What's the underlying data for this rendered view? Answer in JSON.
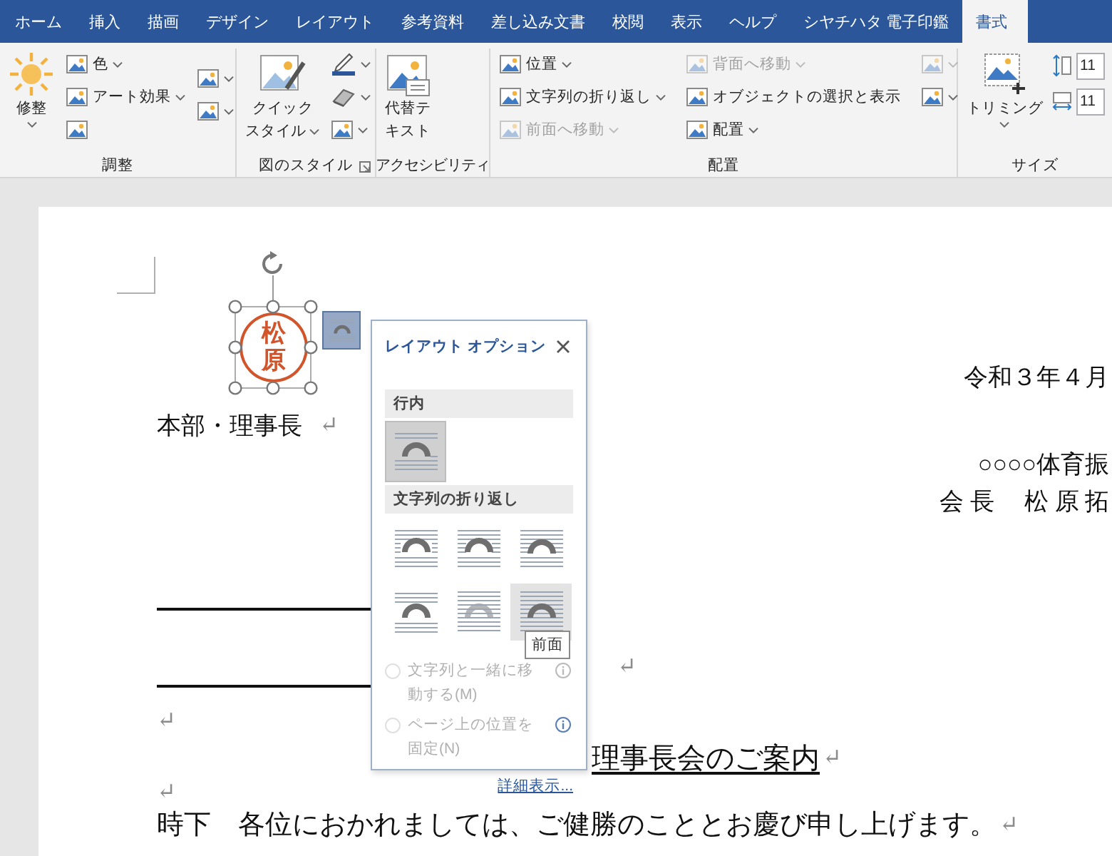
{
  "tabs": [
    {
      "label": "ホーム",
      "selected": false
    },
    {
      "label": "挿入",
      "selected": false
    },
    {
      "label": "描画",
      "selected": false
    },
    {
      "label": "デザイン",
      "selected": false
    },
    {
      "label": "レイアウト",
      "selected": false
    },
    {
      "label": "参考資料",
      "selected": false
    },
    {
      "label": "差し込み文書",
      "selected": false
    },
    {
      "label": "校閲",
      "selected": false
    },
    {
      "label": "表示",
      "selected": false
    },
    {
      "label": "ヘルプ",
      "selected": false
    },
    {
      "label": "シヤチハタ 電子印鑑",
      "selected": false
    },
    {
      "label": "書式",
      "selected": true
    }
  ],
  "ribbon": {
    "groups": [
      {
        "label": "調整",
        "launcher": false,
        "columns": [
          [
            {
              "kind": "large",
              "lines": [
                "修整"
              ],
              "caret": true,
              "disabled": false
            }
          ],
          [
            {
              "kind": "small",
              "label": "色",
              "caret": true,
              "disabled": false
            },
            {
              "kind": "small",
              "label": "アート効果",
              "caret": true,
              "disabled": false
            },
            {
              "kind": "icon",
              "caret": false,
              "disabled": false
            }
          ],
          [
            {
              "kind": "icon",
              "caret": true,
              "disabled": false
            },
            {
              "kind": "icon",
              "caret": true,
              "disabled": false
            }
          ]
        ]
      },
      {
        "label": "図のスタイル",
        "launcher": true,
        "columns": [
          [
            {
              "kind": "large",
              "lines": [
                "クイック",
                "スタイル"
              ],
              "caret": true,
              "disabled": false
            }
          ],
          [
            {
              "kind": "icon",
              "caret": true,
              "disabled": false
            },
            {
              "kind": "icon",
              "caret": true,
              "disabled": false
            },
            {
              "kind": "icon",
              "caret": true,
              "disabled": false
            }
          ]
        ]
      },
      {
        "label": "アクセシビリティ",
        "launcher": false,
        "columns": [
          [
            {
              "kind": "large",
              "lines": [
                "代替テ",
                "キスト"
              ],
              "caret": false,
              "disabled": false
            }
          ]
        ]
      },
      {
        "label": "配置",
        "launcher": false,
        "columns": [
          [
            {
              "kind": "small",
              "label": "位置",
              "caret": true,
              "disabled": false
            },
            {
              "kind": "small",
              "label": "文字列の折り返し",
              "caret": true,
              "disabled": false
            },
            {
              "kind": "small",
              "label": "前面へ移動",
              "caret": true,
              "disabled": true
            }
          ],
          [
            {
              "kind": "small",
              "label": "背面へ移動",
              "caret": true,
              "disabled": true
            },
            {
              "kind": "small",
              "label": "オブジェクトの選択と表示",
              "caret": false,
              "disabled": false
            },
            {
              "kind": "small",
              "label": "配置",
              "caret": true,
              "disabled": false
            }
          ],
          [
            {
              "kind": "icon",
              "caret": true,
              "disabled": true
            },
            {
              "kind": "icon",
              "caret": true,
              "disabled": false
            }
          ]
        ]
      },
      {
        "label": "サイズ",
        "launcher": false,
        "columns": [
          [
            {
              "kind": "large",
              "lines": [
                "トリミング"
              ],
              "caret": true,
              "disabled": false
            }
          ],
          [
            {
              "kind": "field",
              "value": "11",
              "caret": false,
              "disabled": false
            },
            {
              "kind": "field",
              "value": "11",
              "caret": false,
              "disabled": false
            }
          ]
        ]
      }
    ]
  },
  "document": {
    "stamp_text": "松原",
    "lines": [
      {
        "kind": "right",
        "text": "令和３年４月"
      },
      {
        "kind": "left",
        "text": "本部・理事長",
        "mark": "↵"
      },
      {
        "kind": "right",
        "text": "○○○○体育振"
      },
      {
        "kind": "right",
        "text": "会 長　 松 原 拓"
      },
      {
        "kind": "rule"
      },
      {
        "kind": "center",
        "mark": "↵"
      },
      {
        "kind": "rule"
      },
      {
        "kind": "left",
        "mark": "↵"
      },
      {
        "kind": "title",
        "text": "理事長会のご案内",
        "mark": "↵"
      },
      {
        "kind": "left",
        "mark": "↵"
      },
      {
        "kind": "body",
        "text": "時下　各位におかれましては、ご健勝のこととお慶び申し上げます。",
        "mark": "↵"
      }
    ]
  },
  "layout_options": {
    "title": "レイアウト オプション",
    "sections": [
      {
        "heading": "行内",
        "options": [
          {
            "kind": "inline",
            "selected": true,
            "hovered": false
          }
        ]
      },
      {
        "heading": "文字列の折り返し",
        "options": [
          {
            "kind": "square",
            "selected": false,
            "hovered": false
          },
          {
            "kind": "tight",
            "selected": false,
            "hovered": false
          },
          {
            "kind": "through",
            "selected": false,
            "hovered": false
          },
          {
            "kind": "topbottom",
            "selected": false,
            "hovered": false
          },
          {
            "kind": "behind",
            "selected": false,
            "hovered": false
          },
          {
            "kind": "front",
            "selected": false,
            "hovered": true
          }
        ]
      }
    ],
    "tooltip": "前面",
    "positions": [
      {
        "label": "文字列と一緒に移動する(M)",
        "selected": false,
        "disabled": true
      },
      {
        "label": "ページ上の位置を固定(N)",
        "selected": false,
        "disabled": true
      }
    ],
    "link": "詳細表示..."
  }
}
